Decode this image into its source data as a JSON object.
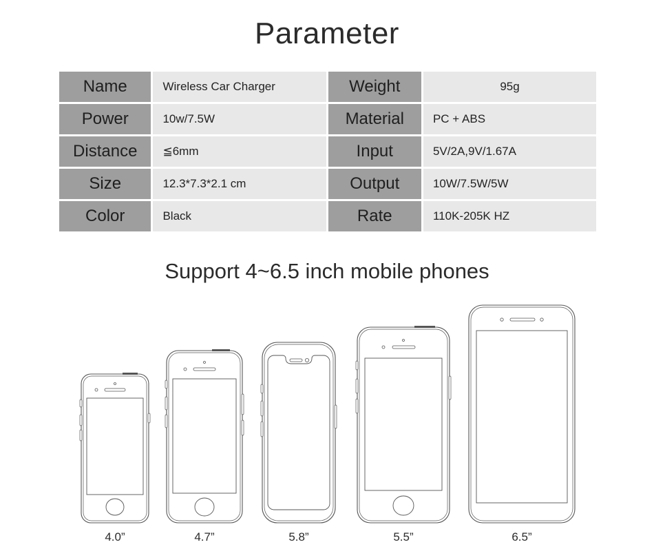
{
  "title": "Parameter",
  "subtitle": "Support 4~6.5 inch mobile phones",
  "colors": {
    "label_bg": "#9e9e9e",
    "value_bg": "#e8e8e8",
    "text": "#232323",
    "outline": "#555555"
  },
  "table": {
    "rows": [
      {
        "label_left": "Name",
        "value_left": "Wireless Car Charger",
        "label_right": "Weight",
        "value_right": "95g",
        "right_center": true
      },
      {
        "label_left": "Power",
        "value_left": "10w/7.5W",
        "label_right": "Material",
        "value_right": "PC + ABS",
        "right_center": false
      },
      {
        "label_left": "Distance",
        "value_left": "≦6mm",
        "label_right": "Input",
        "value_right": "5V/2A,9V/1.67A",
        "right_center": false
      },
      {
        "label_left": "Size",
        "value_left": "12.3*7.3*2.1 cm",
        "label_right": "Output",
        "value_right": "10W/7.5W/5W",
        "right_center": false
      },
      {
        "label_left": "Color",
        "value_left": "Black",
        "label_right": "Rate",
        "value_right": "110K-205K HZ",
        "right_center": false
      }
    ]
  },
  "phones": [
    {
      "label": "4.0”",
      "size": "4.0",
      "style": "home-button",
      "home_button": true,
      "notch": false
    },
    {
      "label": "4.7”",
      "size": "4.7",
      "style": "home-button",
      "home_button": true,
      "notch": false
    },
    {
      "label": "5.8”",
      "size": "5.8",
      "style": "notch",
      "home_button": false,
      "notch": true
    },
    {
      "label": "5.5”",
      "size": "5.5",
      "style": "home-button",
      "home_button": true,
      "notch": false
    },
    {
      "label": "6.5”",
      "size": "6.5",
      "style": "bezel-less",
      "home_button": false,
      "notch": false
    }
  ]
}
